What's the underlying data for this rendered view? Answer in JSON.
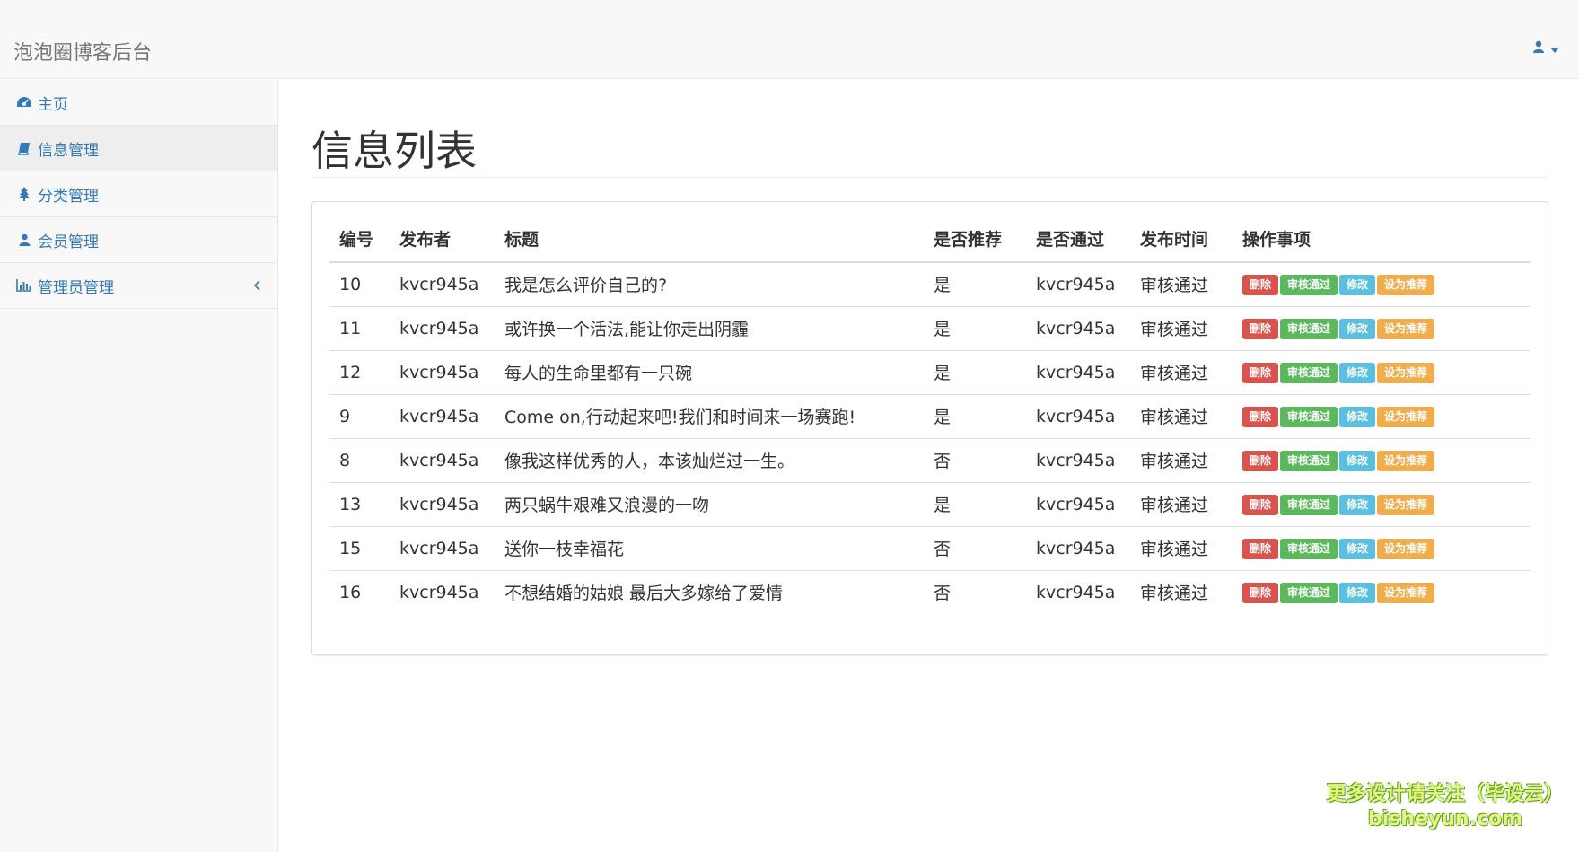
{
  "app": {
    "title": "泡泡圈博客后台"
  },
  "header": {
    "user_icon": "user-icon",
    "dropdown_icon": "caret-down-icon"
  },
  "sidebar": {
    "items": [
      {
        "label": "主页",
        "icon": "dashboard-icon"
      },
      {
        "label": "信息管理",
        "icon": "book-icon",
        "active": true
      },
      {
        "label": "分类管理",
        "icon": "tree-icon"
      },
      {
        "label": "会员管理",
        "icon": "user-icon"
      },
      {
        "label": "管理员管理",
        "icon": "bar-chart-icon",
        "expand_icon": "chevron-left-icon"
      }
    ]
  },
  "main": {
    "page_title": "信息列表",
    "table": {
      "columns": [
        "编号",
        "发布者",
        "标题",
        "是否推荐",
        "是否通过",
        "发布时间",
        "操作事项"
      ],
      "rows": [
        [
          "10",
          "kvcr945a",
          "我是怎么评价自己的?",
          "是",
          "kvcr945a",
          "审核通过"
        ],
        [
          "11",
          "kvcr945a",
          "或许换一个活法,能让你走出阴霾",
          "是",
          "kvcr945a",
          "审核通过"
        ],
        [
          "12",
          "kvcr945a",
          "每人的生命里都有一只碗",
          "是",
          "kvcr945a",
          "审核通过"
        ],
        [
          "9",
          "kvcr945a",
          "Come on,行动起来吧!我们和时间来一场赛跑!",
          "是",
          "kvcr945a",
          "审核通过"
        ],
        [
          "8",
          "kvcr945a",
          "像我这样优秀的人，本该灿烂过一生。",
          "否",
          "kvcr945a",
          "审核通过"
        ],
        [
          "13",
          "kvcr945a",
          "两只蜗牛艰难又浪漫的一吻",
          "是",
          "kvcr945a",
          "审核通过"
        ],
        [
          "15",
          "kvcr945a",
          "送你一枝幸福花",
          "否",
          "kvcr945a",
          "审核通过"
        ],
        [
          "16",
          "kvcr945a",
          "不想结婚的姑娘 最后大多嫁给了爱情",
          "否",
          "kvcr945a",
          "审核通过"
        ]
      ],
      "actions": {
        "delete": "删除",
        "approve": "审核通过",
        "edit": "修改",
        "recommend": "设为推荐"
      }
    }
  },
  "watermark": {
    "line1": "更多设计请关注（毕设云）",
    "line2": "bisheyun.com"
  },
  "colors": {
    "link": "#337ab7",
    "danger": "#d9534f",
    "success": "#5cb85c",
    "info": "#5bc0de",
    "warning": "#f0ad4e"
  }
}
